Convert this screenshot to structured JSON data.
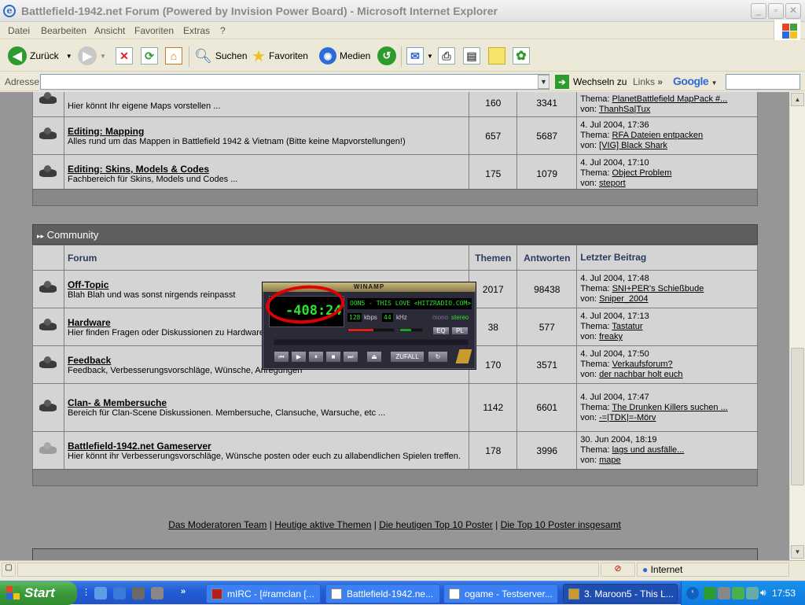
{
  "window": {
    "title": "Battlefield-1942.net Forum (Powered by Invision Power Board) - Microsoft Internet Explorer",
    "minimize": "_",
    "maximize": "▫",
    "close": "✕"
  },
  "menu": [
    "Datei",
    "Bearbeiten",
    "Ansicht",
    "Favoriten",
    "Extras",
    "?"
  ],
  "toolbar": {
    "back": "Zurück",
    "search": "Suchen",
    "favorites": "Favoriten",
    "media": "Medien"
  },
  "address": {
    "label": "Adresse",
    "value": "",
    "go": "Wechseln zu",
    "links": "Links",
    "google": "Google"
  },
  "forums_top": [
    {
      "desc": "Hier könnt Ihr eigene Maps vorstellen ...",
      "topics": "160",
      "replies": "3341",
      "last_date": "",
      "last_topic": "PlanetBattlefield MapPack #...",
      "last_by": "ThanhSa|Tux"
    },
    {
      "name": "Editing: Mapping",
      "desc": "Alles rund um das Mappen in Battlefield 1942 & Vietnam (Bitte keine Mapvorstellungen!)",
      "topics": "657",
      "replies": "5687",
      "last_date": "4. Jul 2004, 17:36",
      "last_topic": "RFA Dateien entpacken",
      "last_by": "[VIG] Black Shark"
    },
    {
      "name": "Editing: Skins, Models & Codes",
      "desc": "Fachbereich für Skins, Models und Codes ...",
      "topics": "175",
      "replies": "1079",
      "last_date": "4. Jul 2004, 17:10",
      "last_topic": "Object Problem",
      "last_by": "steport"
    }
  ],
  "community": {
    "header": "Community",
    "col_forum": "Forum",
    "col_topics": "Themen",
    "col_replies": "Antworten",
    "col_last": "Letzter Beitrag",
    "thema_label": "Thema:",
    "von_label": "von:",
    "forums": [
      {
        "name": "Off-Topic",
        "desc": "Blah Blah und was sonst nirgends reinpasst",
        "topics": "2017",
        "replies": "98438",
        "last_date": "4. Jul 2004, 17:48",
        "last_topic": "SNI+PER's Schießbude",
        "last_by": "Sniper_2004"
      },
      {
        "name": "Hardware",
        "desc": "Hier finden Fragen oder Diskussionen zu Hardware",
        "topics": "38",
        "replies": "577",
        "last_date": "4. Jul 2004, 17:13",
        "last_topic": "Tastatur",
        "last_by": "freaky"
      },
      {
        "name": "Feedback",
        "desc": "Feedback, Verbesserungsvorschläge, Wünsche, Anregungen",
        "topics": "170",
        "replies": "3571",
        "last_date": "4. Jul 2004, 17:50",
        "last_topic": "Verkaufsforum?",
        "last_by": "der nachbar holt euch"
      },
      {
        "name": "Clan- & Membersuche",
        "desc": "Bereich für Clan-Scene Diskussionen. Membersuche, Clansuche, Warsuche, etc ...",
        "topics": "1142",
        "replies": "6601",
        "last_date": "4. Jul 2004, 17:47",
        "last_topic": "The Drunken Killers suchen ...",
        "last_by": "-=|TDK|=-Mörv"
      },
      {
        "name": "Battlefield-1942.net Gameserver",
        "desc": "Hier könnt ihr Verbesserungsvorschläge, Wünsche posten oder euch zu allabendlichen Spielen treffen.",
        "topics": "178",
        "replies": "3996",
        "last_date": "30. Jun 2004, 18:19",
        "last_topic": "lags und ausfälle...",
        "last_by": "mape"
      }
    ]
  },
  "bottom_links": [
    "Das Moderatoren Team",
    "Heutige aktive Themen",
    "Die heutigen Top 10 Poster",
    "Die Top 10 Poster insgesamt"
  ],
  "bottom_sep": "|",
  "status": {
    "zone": "Internet"
  },
  "winamp": {
    "title": "WINAMP",
    "time": "-408:24",
    "song": "OON5 - THIS LOVE <HITZRADIO.COM>",
    "kbps": "128",
    "kbps_label": "kbps",
    "khz": "44",
    "khz_label": "kHz",
    "mono": "mono",
    "stereo": "stereo",
    "eq": "EQ",
    "pl": "PL",
    "shuffle": "ZUFALL"
  },
  "taskbar": {
    "start": "Start",
    "tasks": [
      "mIRC - [#ramclan [...",
      "Battlefield-1942.ne...",
      "ogame - Testserver...",
      "3. Maroon5 - This L..."
    ],
    "clock": "17:53"
  },
  "colors": {
    "title_text": "#8a8a8a",
    "col_head": "#2c3a60",
    "winamp_green": "#2ee22e",
    "annotation": "#e00000",
    "taskbar": "#245dd6",
    "start": "#3a9a3a"
  }
}
